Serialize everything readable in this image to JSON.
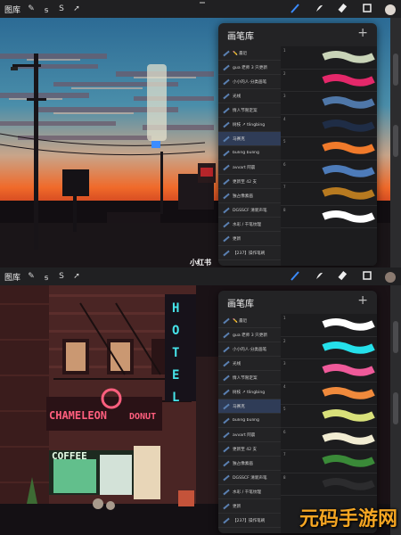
{
  "toolbar_top": {
    "gallery": "图库",
    "left_tools": [
      "✎",
      "ꟊ",
      "S",
      "➚"
    ],
    "right_tools": [
      "brush-icon",
      "smudge-icon",
      "eraser-icon",
      "layers-icon"
    ],
    "color": "#ddd6cf"
  },
  "toolbar_bottom": {
    "gallery": "图库",
    "left_tools": [
      "✎",
      "ꟊ",
      "S",
      "➚"
    ],
    "right_tools": [
      "brush-icon",
      "smudge-icon",
      "eraser-icon",
      "layers-icon"
    ],
    "color": "#8a7a70"
  },
  "watermark_text": "小红书",
  "brand_text": "元码手游网",
  "panel_top": {
    "title": "画笔库",
    "add": "+",
    "sets": [
      "✏️ 最近",
      "gua 老师 3 只更新",
      "小小的人·分类画笔",
      "光线",
      "情人节限定案",
      "树枝 ↗ tlingbing",
      "马赛克",
      "buling buling",
      "avvart 阿晨",
      "更新至 42 支",
      "独占像素画",
      "DGSSCF 清新声笔",
      "水彩 / 干笔纹理",
      "更新",
      "【237】操作笔刷"
    ],
    "active_set": 6,
    "brushes": [
      {
        "num": "1",
        "name": "",
        "color": "#c9d4b8"
      },
      {
        "num": "2",
        "name": "",
        "color": "#e4286a"
      },
      {
        "num": "3",
        "name": "",
        "color": "#4f77a8"
      },
      {
        "num": "4",
        "name": "",
        "color": "#1f2d46"
      },
      {
        "num": "5",
        "name": "",
        "color": "#f07a2b"
      },
      {
        "num": "6",
        "name": "",
        "color": "#4d7bb9"
      },
      {
        "num": "7",
        "name": "",
        "color": "#b77a20"
      },
      {
        "num": "8",
        "name": "",
        "color": "#ffffff"
      }
    ]
  },
  "panel_bottom": {
    "title": "画笔库",
    "add": "+",
    "sets": [
      "✏️ 最近",
      "gua 老师 3 只更新",
      "小小的人·分类画笔",
      "光线",
      "情人节限定案",
      "树枝 ↗ tlingbing",
      "马赛克",
      "buling buling",
      "avvart 阿晨",
      "更新至 42 支",
      "独占像素画",
      "DGSSCF 清新声笔",
      "水彩 / 干笔纹理",
      "更新",
      "【237】操作笔刷"
    ],
    "active_set": 6,
    "brushes": [
      {
        "num": "1",
        "name": "",
        "color": "#ffffff"
      },
      {
        "num": "2",
        "name": "",
        "color": "#25e0ea"
      },
      {
        "num": "3",
        "name": "",
        "color": "#ef5a9a"
      },
      {
        "num": "4",
        "name": "",
        "color": "#f08a3c"
      },
      {
        "num": "5",
        "name": "",
        "color": "#d8e07a"
      },
      {
        "num": "6",
        "name": "",
        "color": "#f1ecd2"
      },
      {
        "num": "7",
        "name": "",
        "color": "#3a8a38"
      },
      {
        "num": "8",
        "name": "",
        "color": "#2c2c2e"
      }
    ]
  },
  "sign_text": {
    "hotel": "HOTEL",
    "chameleon": "CHAMELEON",
    "donut": "DONUT",
    "coffee": "COFFEE"
  }
}
